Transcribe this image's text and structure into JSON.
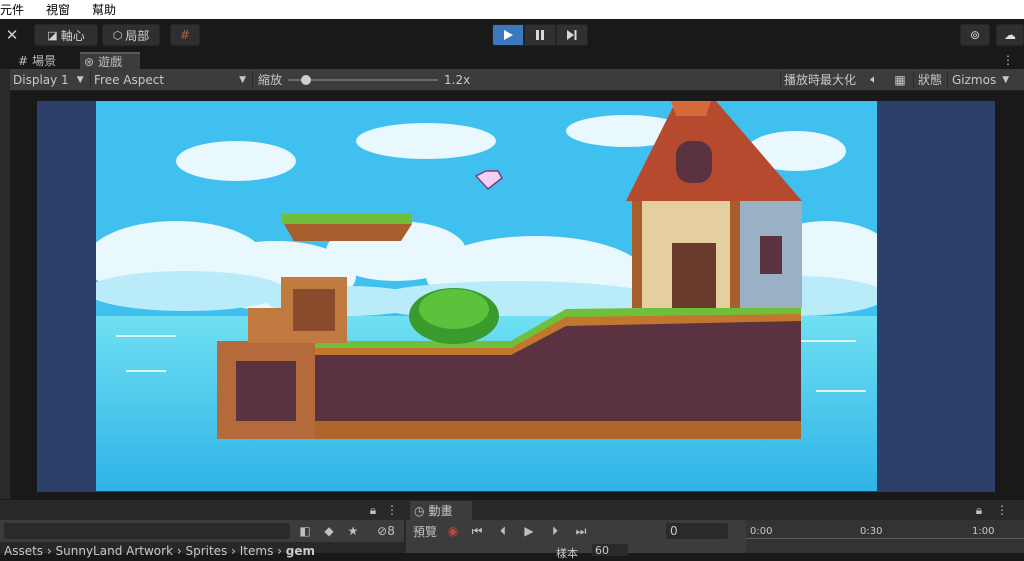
{
  "menu": {
    "items": [
      "元件",
      "視窗",
      "幫助"
    ]
  },
  "toolbar": {
    "pivot_label": "軸心",
    "local_label": "局部"
  },
  "tabs": {
    "scene": "場景",
    "game": "遊戲"
  },
  "game_toolbar": {
    "display": "Display 1",
    "aspect": "Free Aspect",
    "scale_label": "縮放",
    "scale_value": "1.2x",
    "scale_fraction": 0.12,
    "maximize_label": "播放時最大化",
    "stats_label": "狀態",
    "gizmos_label": "Gizmos"
  },
  "bottom": {
    "hidden_count": "8",
    "animation_tab": "動畫",
    "preview_label": "預覽",
    "frame_value": "0",
    "timeline_marks": [
      "0:00",
      "0:30",
      "1:00"
    ],
    "samples_label": "樣本",
    "samples_value": "60",
    "breadcrumb": [
      "Assets",
      "SunnyLand Artwork",
      "Sprites",
      "Items",
      "gem"
    ]
  },
  "colors": {
    "accent": "#3a78bf",
    "sky": "#3fc1ef",
    "viewport_bg": "#2d3f6b"
  }
}
